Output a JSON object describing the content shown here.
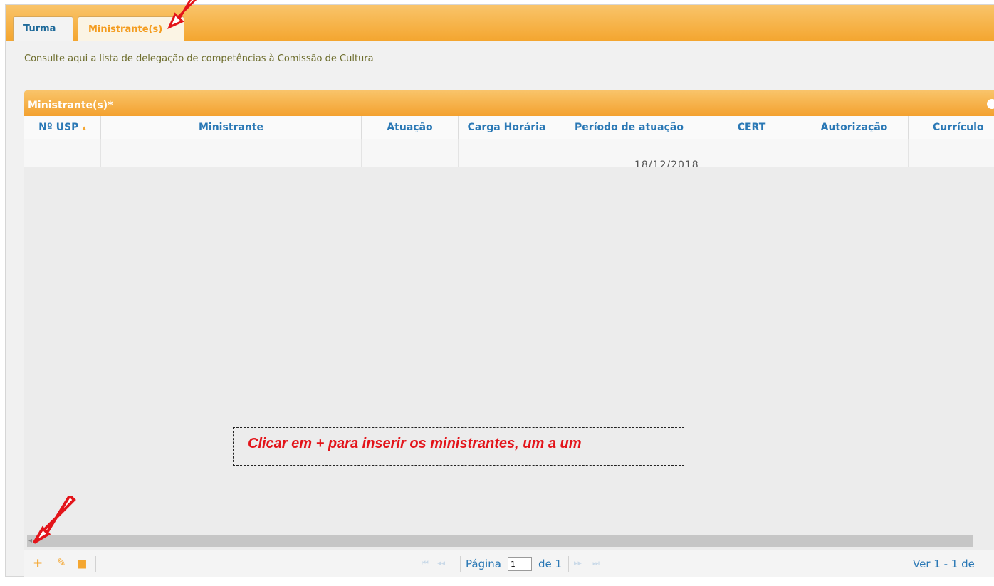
{
  "tabs": [
    {
      "label": "Turma"
    },
    {
      "label": "Ministrante(s)"
    }
  ],
  "description": "Consulte aqui a lista de delegação de competências à Comissão de Cultura",
  "grid": {
    "title": "Ministrante(s)*",
    "columns": [
      {
        "label": "Nº USP"
      },
      {
        "label": "Ministrante"
      },
      {
        "label": "Atuação"
      },
      {
        "label": "Carga Horária"
      },
      {
        "label": "Período de atuação"
      },
      {
        "label": "CERT"
      },
      {
        "label": "Autorização"
      },
      {
        "label": "Currículo"
      }
    ],
    "row_fragment": "18/12/2018"
  },
  "pager": {
    "page_label": "Página",
    "page_value": "1",
    "of_label": "de 1",
    "view_label": "Ver 1 - 1 de"
  },
  "annotation": {
    "text": "Clicar em + para inserir os ministrantes, um a um"
  },
  "colors": {
    "accent": "#f4a630",
    "link": "#2a78b5",
    "annotation": "#e3141a"
  }
}
